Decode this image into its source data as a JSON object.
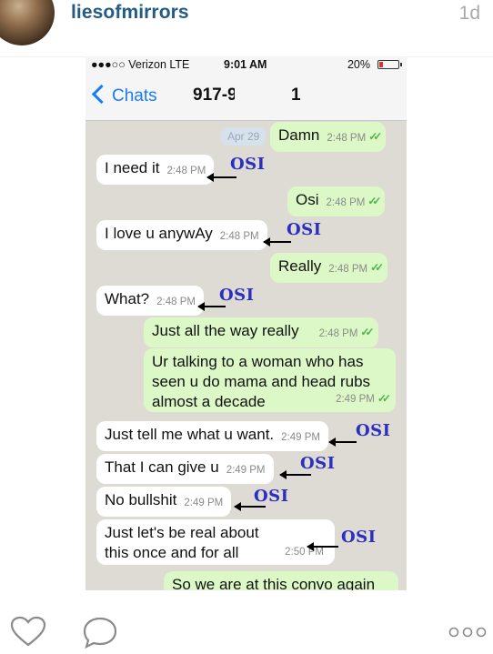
{
  "post": {
    "username": "liesofmirrors",
    "time_ago": "1d"
  },
  "screenshot": {
    "status_bar": {
      "carrier": "●●●○○ Verizon  LTE",
      "time": "9:01 AM",
      "battery": "20%",
      "battery_level": 0.2
    },
    "nav": {
      "back_label": "Chats",
      "contact_prefix": "917-9",
      "contact_suffix": "1"
    },
    "date_chip": "Apr 29",
    "messages": [
      {
        "text": "Damn",
        "time": "2:48 PM",
        "ticks": "✓✓"
      },
      {
        "text": "I need it",
        "time": "2:48 PM"
      },
      {
        "text": "Osi",
        "time": "2:48 PM",
        "ticks": "✓✓"
      },
      {
        "text": "I love u anywAy",
        "time": "2:48 PM"
      },
      {
        "text": "Really",
        "time": "2:48 PM",
        "ticks": "✓✓"
      },
      {
        "text": "What?",
        "time": "2:48 PM"
      },
      {
        "text": "Just all the way really",
        "time": "2:48 PM",
        "ticks": "✓✓"
      },
      {
        "text": "Ur talking to a woman who has seen u do mama and head rubs almost a decade",
        "time": "2:49 PM",
        "ticks": "✓✓"
      },
      {
        "text": "Just tell me what u want.",
        "time": "2:49 PM"
      },
      {
        "text": "That I can give u",
        "time": "2:49 PM"
      },
      {
        "text": "No bullshit",
        "time": "2:49 PM"
      },
      {
        "text": "Just let's be real about this once and for all",
        "time": "2:50 PM"
      },
      {
        "text": "So we are at this convo again"
      }
    ],
    "annotation_label": "OSI"
  },
  "colors": {
    "incoming": "#ffffff",
    "outgoing": "#dcf8c6",
    "annotation": "#2b2fbf",
    "link_blue": "#1a7cf5"
  },
  "actions": {
    "like_icon": "heart-icon",
    "comment_icon": "comment-icon",
    "more_icon": "more-options-icon"
  }
}
